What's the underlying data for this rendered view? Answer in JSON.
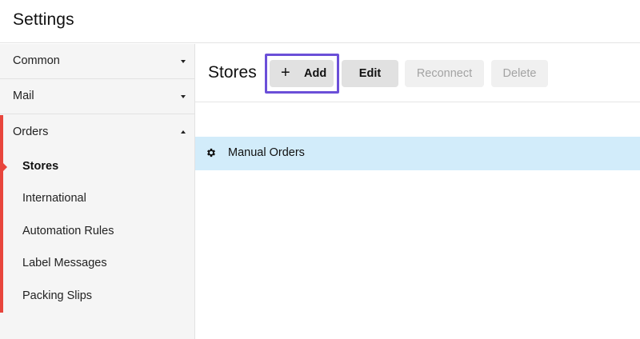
{
  "app": {
    "title": "Settings"
  },
  "sidebar": {
    "groups": [
      {
        "label": "Common",
        "expanded": false
      },
      {
        "label": "Mail",
        "expanded": false
      },
      {
        "label": "Orders",
        "expanded": true
      }
    ],
    "orders_items": [
      {
        "label": "Stores",
        "active": true
      },
      {
        "label": "International",
        "active": false
      },
      {
        "label": "Automation Rules",
        "active": false
      },
      {
        "label": "Label Messages",
        "active": false
      },
      {
        "label": "Packing Slips",
        "active": false
      }
    ]
  },
  "main": {
    "title": "Stores",
    "toolbar": {
      "add_label": "Add",
      "edit_label": "Edit",
      "reconnect_label": "Reconnect",
      "delete_label": "Delete"
    },
    "stores": [
      {
        "name": "Manual Orders",
        "icon": "gear-icon",
        "selected": true
      }
    ]
  },
  "colors": {
    "accent_red": "#e8453c",
    "focus_ring": "#6b4fd8",
    "selected_row": "#d2ecfa"
  }
}
